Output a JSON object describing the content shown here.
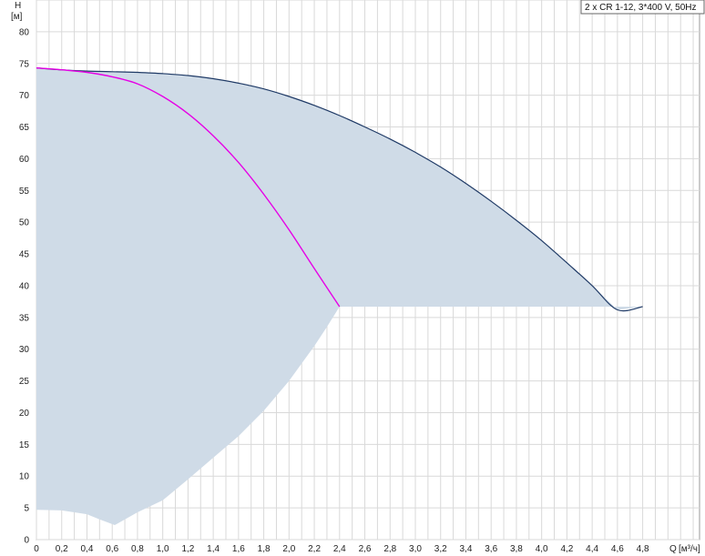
{
  "chart_data": {
    "type": "line",
    "title": "",
    "legend": {
      "text": "2 x CR 1-12, 3*400 V, 50Hz",
      "placement": "top-right"
    },
    "xlabel": "Q",
    "xunit": "[м³/ч]",
    "ylabel": "H",
    "yunit": "[м]",
    "xlim": [
      0,
      5.25
    ],
    "ylim": [
      0,
      85
    ],
    "grid": true,
    "x_ticks": [
      0,
      0.2,
      0.4,
      0.6,
      0.8,
      1.0,
      1.2,
      1.4,
      1.6,
      1.8,
      2.0,
      2.2,
      2.4,
      2.6,
      2.8,
      3.0,
      3.2,
      3.4,
      3.6,
      3.8,
      4.0,
      4.2,
      4.4,
      4.6,
      4.8
    ],
    "x_tick_labels": [
      "0",
      "0,2",
      "0,4",
      "0,6",
      "0,8",
      "1,0",
      "1,2",
      "1,4",
      "1,6",
      "1,8",
      "2,0",
      "2,2",
      "2,4",
      "2,6",
      "2,8",
      "3,0",
      "3,2",
      "3,4",
      "3,6",
      "3,8",
      "4,0",
      "4,2",
      "4,4",
      "4,6",
      "4,8"
    ],
    "y_ticks": [
      0,
      5,
      10,
      15,
      20,
      25,
      30,
      35,
      40,
      45,
      50,
      55,
      60,
      65,
      70,
      75,
      80
    ],
    "y_tick_labels": [
      "0",
      "5",
      "10",
      "15",
      "20",
      "25",
      "30",
      "35",
      "40",
      "45",
      "50",
      "55",
      "60",
      "65",
      "70",
      "75",
      "80"
    ],
    "operating_area": {
      "color": "#cfdbe7",
      "points": [
        [
          0,
          74.3
        ],
        [
          0.2,
          74.0
        ],
        [
          0.4,
          73.8
        ],
        [
          0.6,
          73.7
        ],
        [
          0.8,
          73.6
        ],
        [
          1.0,
          73.4
        ],
        [
          1.2,
          73.1
        ],
        [
          1.4,
          72.6
        ],
        [
          1.6,
          71.9
        ],
        [
          1.8,
          71.0
        ],
        [
          2.0,
          69.8
        ],
        [
          2.2,
          68.4
        ],
        [
          2.4,
          66.8
        ],
        [
          2.6,
          65.0
        ],
        [
          2.8,
          63.1
        ],
        [
          3.0,
          61.0
        ],
        [
          3.2,
          58.7
        ],
        [
          3.4,
          56.1
        ],
        [
          3.6,
          53.3
        ],
        [
          3.8,
          50.3
        ],
        [
          4.0,
          47.1
        ],
        [
          4.2,
          43.6
        ],
        [
          4.4,
          40.0
        ],
        [
          4.6,
          36.2
        ],
        [
          4.8,
          36.7
        ],
        [
          2.4,
          36.7
        ],
        [
          2.3,
          33.5
        ],
        [
          2.2,
          30.5
        ],
        [
          2.0,
          25.0
        ],
        [
          1.8,
          20.3
        ],
        [
          1.6,
          16.3
        ],
        [
          1.4,
          12.9
        ],
        [
          1.2,
          9.5
        ],
        [
          1.0,
          6.2
        ],
        [
          0.8,
          4.3
        ],
        [
          0.62,
          2.3
        ],
        [
          0.5,
          3.2
        ],
        [
          0.4,
          4.0
        ],
        [
          0.2,
          4.6
        ],
        [
          0,
          4.7
        ]
      ]
    },
    "series": [
      {
        "color": "#1f3a66",
        "x": [
          0,
          0.2,
          0.4,
          0.6,
          0.8,
          1.0,
          1.2,
          1.4,
          1.6,
          1.8,
          2.0,
          2.2,
          2.4,
          2.6,
          2.8,
          3.0,
          3.2,
          3.4,
          3.6,
          3.8,
          4.0,
          4.2,
          4.4,
          4.6,
          4.8
        ],
        "y": [
          74.3,
          74.0,
          73.8,
          73.7,
          73.6,
          73.4,
          73.1,
          72.6,
          71.9,
          71.0,
          69.8,
          68.4,
          66.8,
          65.0,
          63.1,
          61.0,
          58.7,
          56.1,
          53.3,
          50.3,
          47.1,
          43.6,
          40.0,
          36.2,
          36.7
        ]
      },
      {
        "color": "#e600e6",
        "x": [
          0,
          0.2,
          0.4,
          0.6,
          0.8,
          1.0,
          1.2,
          1.4,
          1.6,
          1.8,
          2.0,
          2.2,
          2.4
        ],
        "y": [
          74.3,
          74.0,
          73.6,
          72.9,
          71.8,
          69.8,
          67.1,
          63.6,
          59.4,
          54.4,
          48.8,
          42.7,
          36.7
        ]
      }
    ]
  }
}
